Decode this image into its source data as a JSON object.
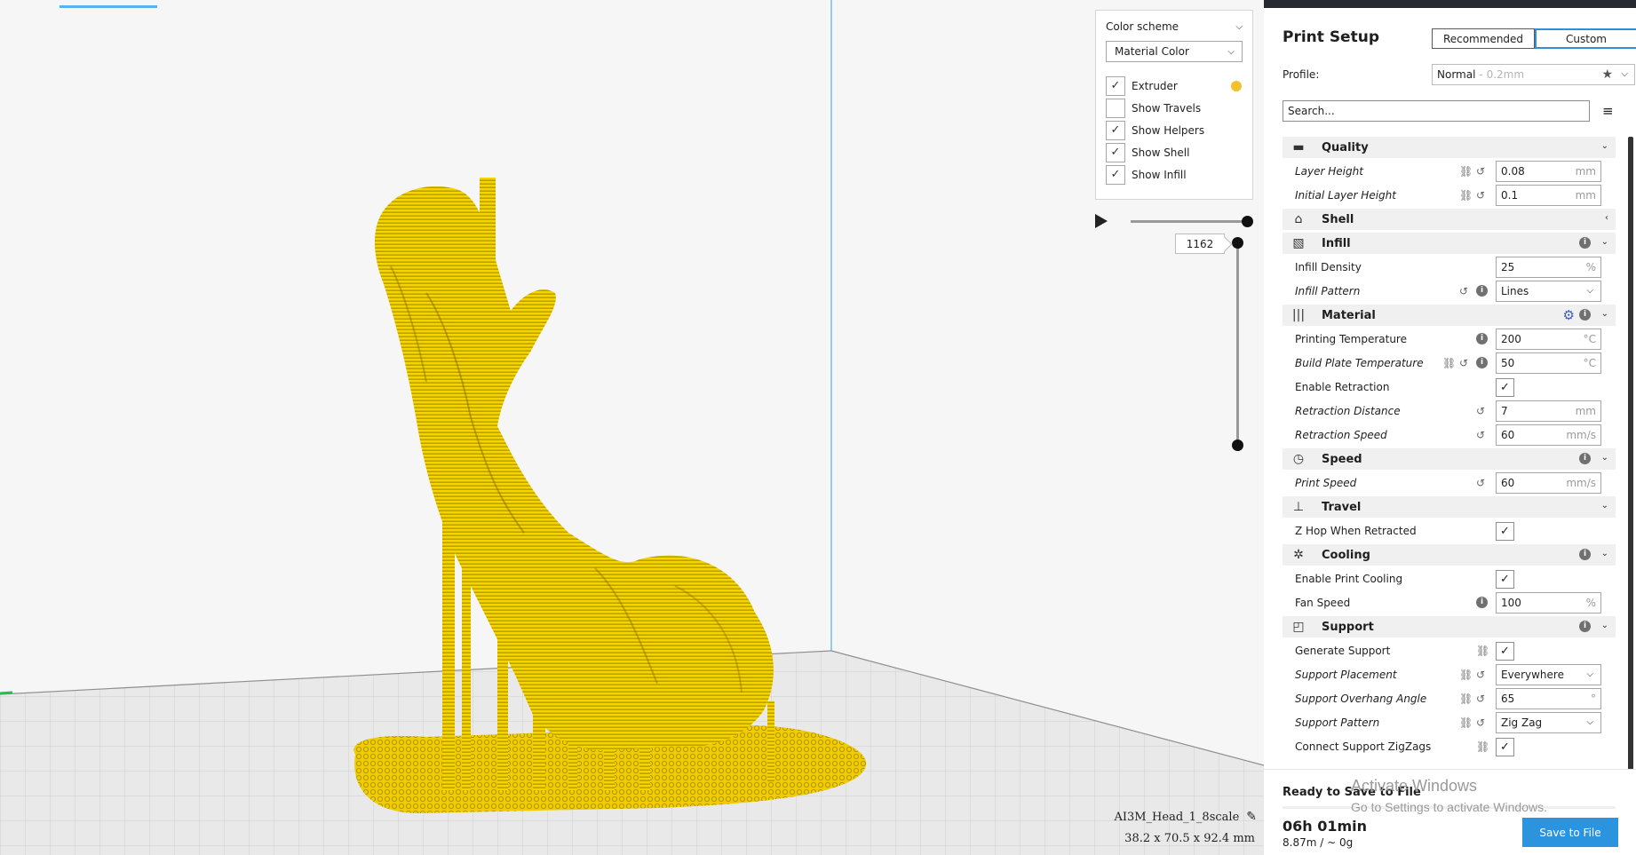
{
  "viewport": {
    "color_panel": {
      "header": "Color scheme",
      "selected_scheme": "Material Color",
      "options": [
        {
          "label": "Extruder",
          "checked": true,
          "swatch": "#f2c12e"
        },
        {
          "label": "Show Travels",
          "checked": false
        },
        {
          "label": "Show Helpers",
          "checked": true
        },
        {
          "label": "Show Shell",
          "checked": true
        },
        {
          "label": "Show Infill",
          "checked": true
        }
      ]
    },
    "layer_number": "1162",
    "object_name": "AI3M_Head_1_8scale",
    "object_dims": "38.2 x 70.5 x 92.4 mm",
    "model_color": "#f5d400"
  },
  "sidebar": {
    "title": "Print Setup",
    "modes": [
      "Recommended",
      "Custom"
    ],
    "active_mode": "Custom",
    "profile_label": "Profile:",
    "profile_name": "Normal",
    "profile_detail": "- 0.2mm",
    "search_placeholder": "Search...",
    "settings": [
      {
        "type": "cat",
        "icon": "quality-icon",
        "glyph": "▬",
        "name": "Quality",
        "chev": "⌄"
      },
      {
        "type": "set",
        "name": "Layer Height",
        "italic": true,
        "icons": [
          "link",
          "reset"
        ],
        "value": "0.08",
        "unit": "mm"
      },
      {
        "type": "set",
        "name": "Initial Layer Height",
        "italic": true,
        "icons": [
          "link",
          "reset"
        ],
        "value": "0.1",
        "unit": "mm"
      },
      {
        "type": "cat",
        "icon": "shell-icon",
        "glyph": "⌂",
        "name": "Shell",
        "chev": "‹"
      },
      {
        "type": "cat",
        "icon": "infill-icon",
        "glyph": "▧",
        "name": "Infill",
        "info": true,
        "chev": "⌄"
      },
      {
        "type": "set",
        "name": "Infill Density",
        "italic": false,
        "icons": [],
        "value": "25",
        "unit": "%"
      },
      {
        "type": "set",
        "name": "Infill Pattern",
        "italic": true,
        "icons": [
          "reset",
          "info"
        ],
        "value": "Lines",
        "dropdown": true
      },
      {
        "type": "cat",
        "icon": "material-icon",
        "glyph": "|||",
        "name": "Material",
        "gear": true,
        "info": true,
        "chev": "⌄"
      },
      {
        "type": "set",
        "name": "Printing Temperature",
        "italic": false,
        "icons": [
          "info"
        ],
        "value": "200",
        "unit": "°C"
      },
      {
        "type": "set",
        "name": "Build Plate Temperature",
        "italic": true,
        "icons": [
          "link",
          "reset",
          "info"
        ],
        "value": "50",
        "unit": "°C"
      },
      {
        "type": "set",
        "name": "Enable Retraction",
        "italic": false,
        "icons": [],
        "checkbox": true
      },
      {
        "type": "set",
        "name": "Retraction Distance",
        "italic": true,
        "icons": [
          "reset"
        ],
        "value": "7",
        "unit": "mm"
      },
      {
        "type": "set",
        "name": "Retraction Speed",
        "italic": true,
        "icons": [
          "reset"
        ],
        "value": "60",
        "unit": "mm/s"
      },
      {
        "type": "cat",
        "icon": "speed-icon",
        "glyph": "◷",
        "name": "Speed",
        "info": true,
        "chev": "⌄"
      },
      {
        "type": "set",
        "name": "Print Speed",
        "italic": true,
        "icons": [
          "reset"
        ],
        "value": "60",
        "unit": "mm/s"
      },
      {
        "type": "cat",
        "icon": "travel-icon",
        "glyph": "⊥",
        "name": "Travel",
        "chev": "⌄"
      },
      {
        "type": "set",
        "name": "Z Hop When Retracted",
        "italic": false,
        "icons": [],
        "checkbox": true
      },
      {
        "type": "cat",
        "icon": "cooling-icon",
        "glyph": "✲",
        "name": "Cooling",
        "info": true,
        "chev": "⌄"
      },
      {
        "type": "set",
        "name": "Enable Print Cooling",
        "italic": false,
        "icons": [],
        "checkbox": true
      },
      {
        "type": "set",
        "name": "Fan Speed",
        "italic": false,
        "icons": [
          "info"
        ],
        "value": "100",
        "unit": "%"
      },
      {
        "type": "cat",
        "icon": "support-icon",
        "glyph": "◰",
        "name": "Support",
        "info": true,
        "chev": "⌄"
      },
      {
        "type": "set",
        "name": "Generate Support",
        "italic": false,
        "icons": [
          "link"
        ],
        "checkbox": true
      },
      {
        "type": "set",
        "name": "Support Placement",
        "italic": true,
        "icons": [
          "link",
          "reset"
        ],
        "value": "Everywhere",
        "dropdown": true
      },
      {
        "type": "set",
        "name": "Support Overhang Angle",
        "italic": true,
        "icons": [
          "link",
          "reset"
        ],
        "value": "65",
        "unit": "°"
      },
      {
        "type": "set",
        "name": "Support Pattern",
        "italic": true,
        "icons": [
          "link",
          "reset"
        ],
        "value": "Zig Zag",
        "dropdown": true
      },
      {
        "type": "set",
        "name": "Connect Support ZigZags",
        "italic": false,
        "icons": [
          "link"
        ],
        "checkbox": true
      }
    ],
    "ready_text": "Ready to Save to File",
    "print_time": "06h 01min",
    "material_usage": "8.87m / ~ 0g",
    "save_label": "Save to File",
    "accent_color": "#2c94de"
  },
  "watermark": {
    "line1": "Activate Windows",
    "line2": "Go to Settings to activate Windows."
  }
}
